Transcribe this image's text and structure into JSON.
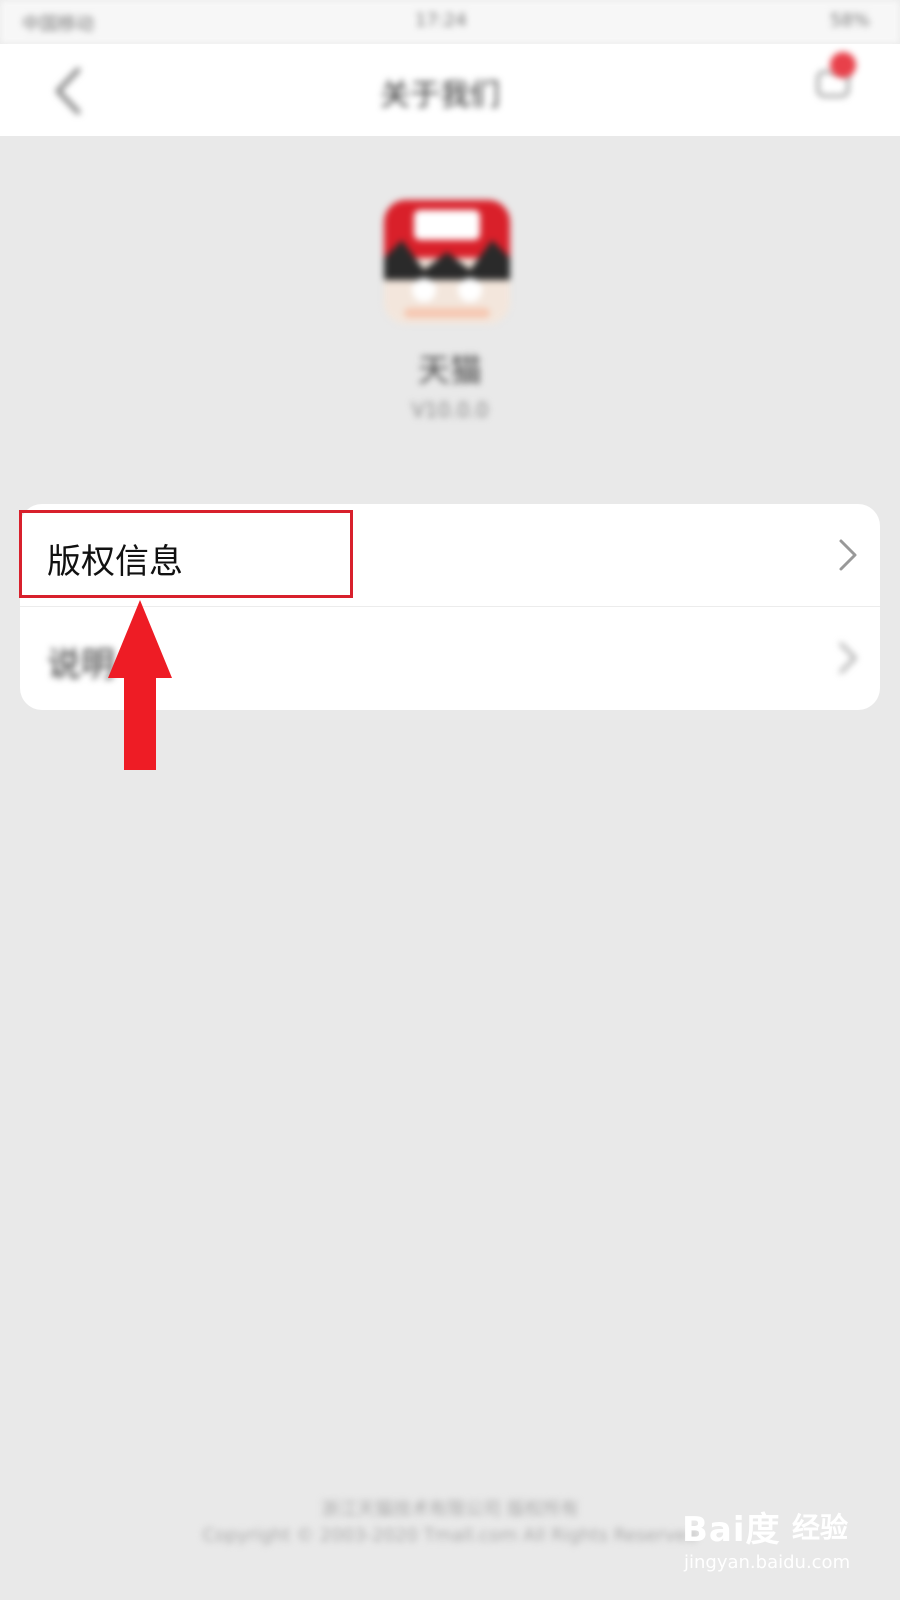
{
  "status_bar": {
    "carrier": "中国移动",
    "time": "17:24",
    "battery": "58%"
  },
  "nav": {
    "title": "关于我们",
    "back_icon": "chevron-left-icon",
    "message_icon": "message-icon"
  },
  "app": {
    "name": "天猫",
    "version": "V10.0.0"
  },
  "menu": {
    "items": [
      {
        "label": "版权信息",
        "icon": "chevron-right-icon"
      },
      {
        "label": "说明",
        "icon": "chevron-right-icon"
      }
    ]
  },
  "footer": {
    "line1": "浙江天猫技术有限公司 版权所有",
    "line2": "Copyright © 2003-2020 Tmall.com All Rights Reserved"
  },
  "watermark": {
    "brand": "Bai度",
    "name": "经验",
    "url": "jingyan.baidu.com"
  },
  "colors": {
    "annotation_red": "#d8202c",
    "arrow_red": "#ee1c25",
    "background": "#e9e9e9"
  }
}
